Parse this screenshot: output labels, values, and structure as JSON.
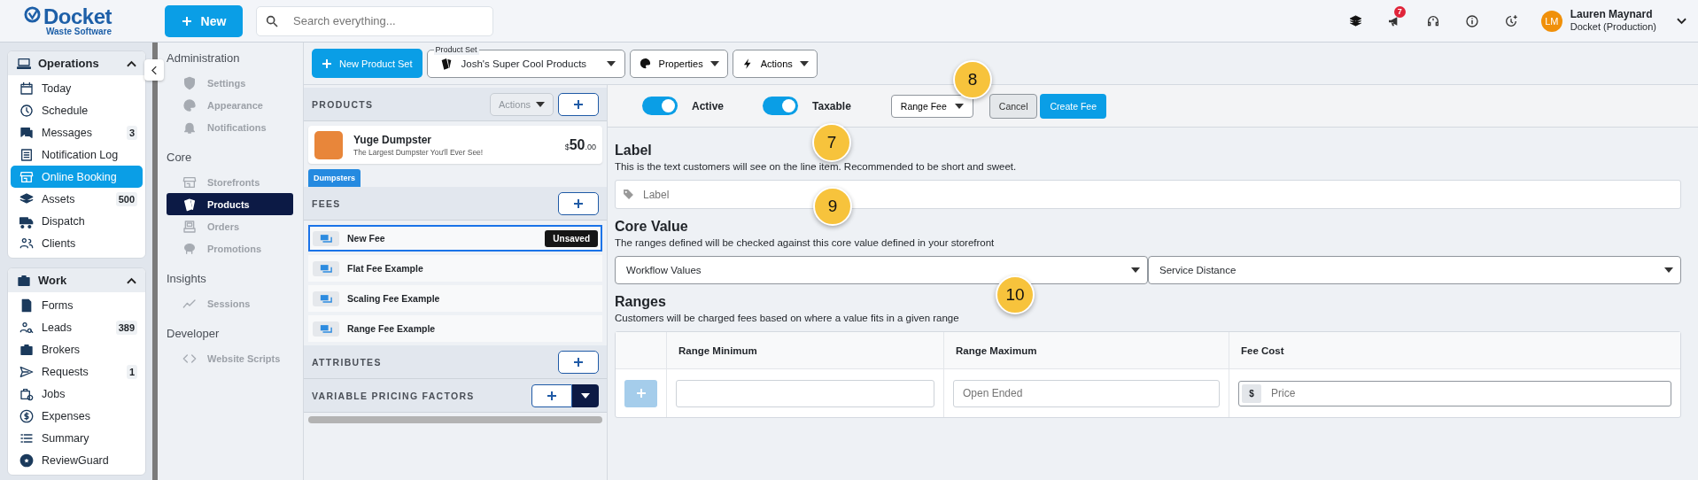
{
  "header": {
    "logo": {
      "name": "Docket",
      "tagline": "Waste Software"
    },
    "new_button": "New",
    "search": {
      "placeholder": "Search everything..."
    },
    "notification_count": "7",
    "user": {
      "initials": "LM",
      "name": "Lauren Maynard",
      "org": "Docket (Production)"
    }
  },
  "nav_groups": [
    {
      "title": "Operations",
      "expanded": true,
      "items": [
        {
          "label": "Today",
          "selected": false
        },
        {
          "label": "Schedule",
          "selected": false
        },
        {
          "label": "Messages",
          "selected": false,
          "badge": "3"
        },
        {
          "label": "Notification Log",
          "selected": false
        },
        {
          "label": "Online Booking",
          "selected": true
        },
        {
          "label": "Assets",
          "selected": false,
          "badge": "500"
        },
        {
          "label": "Dispatch",
          "selected": false
        },
        {
          "label": "Clients",
          "selected": false
        }
      ]
    },
    {
      "title": "Work",
      "expanded": true,
      "items": [
        {
          "label": "Forms",
          "selected": false
        },
        {
          "label": "Leads",
          "selected": false,
          "badge": "389"
        },
        {
          "label": "Brokers",
          "selected": false
        },
        {
          "label": "Requests",
          "selected": false,
          "badge": "1"
        },
        {
          "label": "Jobs",
          "selected": false
        },
        {
          "label": "Expenses",
          "selected": false
        },
        {
          "label": "Summary",
          "selected": false
        },
        {
          "label": "ReviewGuard",
          "selected": false
        }
      ]
    }
  ],
  "admin_nav": [
    {
      "title": "Administration",
      "items": [
        {
          "label": "Settings",
          "selected": false
        },
        {
          "label": "Appearance",
          "selected": false
        },
        {
          "label": "Notifications",
          "selected": false
        }
      ]
    },
    {
      "title": "Core",
      "items": [
        {
          "label": "Storefronts",
          "selected": false
        },
        {
          "label": "Products",
          "selected": true
        },
        {
          "label": "Orders",
          "selected": false
        },
        {
          "label": "Promotions",
          "selected": false
        }
      ]
    },
    {
      "title": "Insights",
      "items": [
        {
          "label": "Sessions",
          "selected": false
        }
      ]
    },
    {
      "title": "Developer",
      "items": [
        {
          "label": "Website Scripts",
          "selected": false
        }
      ]
    }
  ],
  "toolbar": {
    "new_product_set": "New Product Set",
    "product_set": {
      "label": "Product Set",
      "value": "Josh's Super Cool Products"
    },
    "properties": "Properties",
    "actions": "Actions"
  },
  "products": {
    "title": "PRODUCTS",
    "actions_button": {
      "label": "Actions",
      "disabled": true
    },
    "item": {
      "name": "Yuge Dumpster",
      "description": "The Largest Dumpster You'll Ever See!",
      "currency": "$",
      "price": "50",
      "cents": ".00"
    },
    "tag": "Dumpsters"
  },
  "fees": {
    "title": "FEES",
    "items": [
      {
        "label": "New Fee",
        "selected": true,
        "badge": "Unsaved"
      },
      {
        "label": "Flat Fee Example",
        "selected": false
      },
      {
        "label": "Scaling Fee Example",
        "selected": false
      },
      {
        "label": "Range Fee Example",
        "selected": false
      }
    ]
  },
  "attributes": {
    "title": "ATTRIBUTES"
  },
  "variable_pricing": {
    "title": "VARIABLE PRICING FACTORS"
  },
  "fee_form": {
    "toggles": [
      {
        "label": "Active",
        "on": true
      },
      {
        "label": "Taxable",
        "on": true
      }
    ],
    "fee_type": "Range Fee",
    "cancel": "Cancel",
    "create": "Create Fee",
    "label_section": {
      "title": "Label",
      "description": "This is the text customers will see on the line item. Recommended to be short and sweet.",
      "placeholder": "Label"
    },
    "core_value": {
      "title": "Core Value",
      "description": "The ranges defined will be checked against this core value defined in your storefront",
      "selects": [
        "Workflow Values",
        "Service Distance"
      ]
    },
    "ranges": {
      "title": "Ranges",
      "description": "Customers will be charged fees based on where a value fits in a given range",
      "columns": [
        "Range Minimum",
        "Range Maximum",
        "Fee Cost"
      ],
      "row": {
        "max_placeholder": "Open Ended",
        "currency": "$",
        "price_placeholder": "Price"
      }
    }
  },
  "callouts": [
    "7",
    "8",
    "9",
    "10"
  ]
}
